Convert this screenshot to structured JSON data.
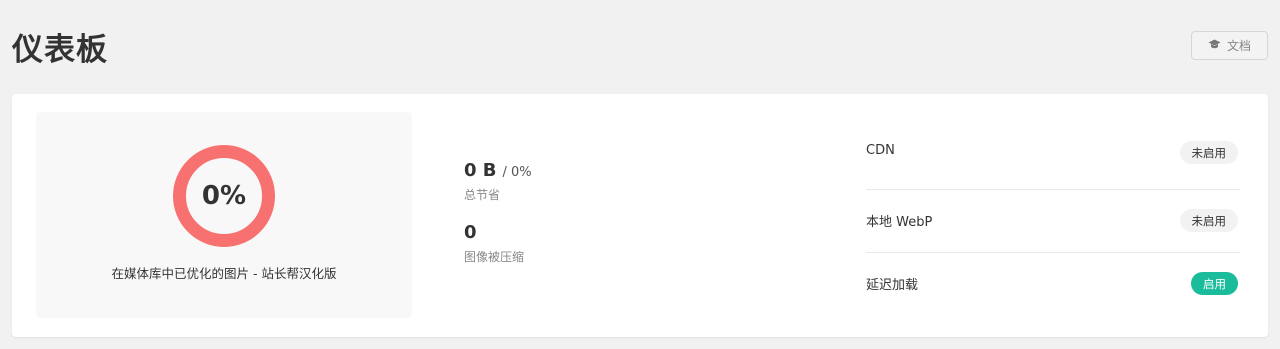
{
  "header": {
    "title": "仪表板",
    "docs_label": "文档"
  },
  "summary": {
    "percent_label": "0%",
    "percent_value": 0,
    "caption": "在媒体库中已优化的图片 - 站长帮汉化版",
    "ring_color": "#f87171"
  },
  "stats": {
    "savings_value": "0 B",
    "savings_percent": "/ 0%",
    "savings_label": "总节省",
    "images_value": "0",
    "images_label": "图像被压缩"
  },
  "features": [
    {
      "name": "CDN",
      "status": "未启用",
      "enabled": false
    },
    {
      "name": "本地 WebP",
      "status": "未启用",
      "enabled": false
    },
    {
      "name": "延迟加载",
      "status": "启用",
      "enabled": true
    }
  ],
  "colors": {
    "accent": "#1abc9c",
    "background": "#f1f1f1"
  }
}
